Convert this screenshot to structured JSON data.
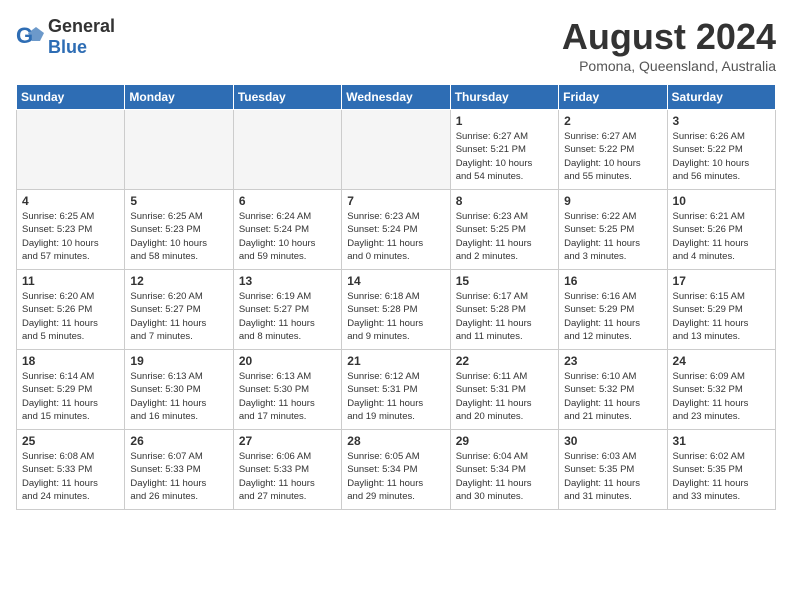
{
  "header": {
    "logo_general": "General",
    "logo_blue": "Blue",
    "month_title": "August 2024",
    "location": "Pomona, Queensland, Australia"
  },
  "weekdays": [
    "Sunday",
    "Monday",
    "Tuesday",
    "Wednesday",
    "Thursday",
    "Friday",
    "Saturday"
  ],
  "weeks": [
    [
      {
        "day": "",
        "info": ""
      },
      {
        "day": "",
        "info": ""
      },
      {
        "day": "",
        "info": ""
      },
      {
        "day": "",
        "info": ""
      },
      {
        "day": "1",
        "info": "Sunrise: 6:27 AM\nSunset: 5:21 PM\nDaylight: 10 hours\nand 54 minutes."
      },
      {
        "day": "2",
        "info": "Sunrise: 6:27 AM\nSunset: 5:22 PM\nDaylight: 10 hours\nand 55 minutes."
      },
      {
        "day": "3",
        "info": "Sunrise: 6:26 AM\nSunset: 5:22 PM\nDaylight: 10 hours\nand 56 minutes."
      }
    ],
    [
      {
        "day": "4",
        "info": "Sunrise: 6:25 AM\nSunset: 5:23 PM\nDaylight: 10 hours\nand 57 minutes."
      },
      {
        "day": "5",
        "info": "Sunrise: 6:25 AM\nSunset: 5:23 PM\nDaylight: 10 hours\nand 58 minutes."
      },
      {
        "day": "6",
        "info": "Sunrise: 6:24 AM\nSunset: 5:24 PM\nDaylight: 10 hours\nand 59 minutes."
      },
      {
        "day": "7",
        "info": "Sunrise: 6:23 AM\nSunset: 5:24 PM\nDaylight: 11 hours\nand 0 minutes."
      },
      {
        "day": "8",
        "info": "Sunrise: 6:23 AM\nSunset: 5:25 PM\nDaylight: 11 hours\nand 2 minutes."
      },
      {
        "day": "9",
        "info": "Sunrise: 6:22 AM\nSunset: 5:25 PM\nDaylight: 11 hours\nand 3 minutes."
      },
      {
        "day": "10",
        "info": "Sunrise: 6:21 AM\nSunset: 5:26 PM\nDaylight: 11 hours\nand 4 minutes."
      }
    ],
    [
      {
        "day": "11",
        "info": "Sunrise: 6:20 AM\nSunset: 5:26 PM\nDaylight: 11 hours\nand 5 minutes."
      },
      {
        "day": "12",
        "info": "Sunrise: 6:20 AM\nSunset: 5:27 PM\nDaylight: 11 hours\nand 7 minutes."
      },
      {
        "day": "13",
        "info": "Sunrise: 6:19 AM\nSunset: 5:27 PM\nDaylight: 11 hours\nand 8 minutes."
      },
      {
        "day": "14",
        "info": "Sunrise: 6:18 AM\nSunset: 5:28 PM\nDaylight: 11 hours\nand 9 minutes."
      },
      {
        "day": "15",
        "info": "Sunrise: 6:17 AM\nSunset: 5:28 PM\nDaylight: 11 hours\nand 11 minutes."
      },
      {
        "day": "16",
        "info": "Sunrise: 6:16 AM\nSunset: 5:29 PM\nDaylight: 11 hours\nand 12 minutes."
      },
      {
        "day": "17",
        "info": "Sunrise: 6:15 AM\nSunset: 5:29 PM\nDaylight: 11 hours\nand 13 minutes."
      }
    ],
    [
      {
        "day": "18",
        "info": "Sunrise: 6:14 AM\nSunset: 5:29 PM\nDaylight: 11 hours\nand 15 minutes."
      },
      {
        "day": "19",
        "info": "Sunrise: 6:13 AM\nSunset: 5:30 PM\nDaylight: 11 hours\nand 16 minutes."
      },
      {
        "day": "20",
        "info": "Sunrise: 6:13 AM\nSunset: 5:30 PM\nDaylight: 11 hours\nand 17 minutes."
      },
      {
        "day": "21",
        "info": "Sunrise: 6:12 AM\nSunset: 5:31 PM\nDaylight: 11 hours\nand 19 minutes."
      },
      {
        "day": "22",
        "info": "Sunrise: 6:11 AM\nSunset: 5:31 PM\nDaylight: 11 hours\nand 20 minutes."
      },
      {
        "day": "23",
        "info": "Sunrise: 6:10 AM\nSunset: 5:32 PM\nDaylight: 11 hours\nand 21 minutes."
      },
      {
        "day": "24",
        "info": "Sunrise: 6:09 AM\nSunset: 5:32 PM\nDaylight: 11 hours\nand 23 minutes."
      }
    ],
    [
      {
        "day": "25",
        "info": "Sunrise: 6:08 AM\nSunset: 5:33 PM\nDaylight: 11 hours\nand 24 minutes."
      },
      {
        "day": "26",
        "info": "Sunrise: 6:07 AM\nSunset: 5:33 PM\nDaylight: 11 hours\nand 26 minutes."
      },
      {
        "day": "27",
        "info": "Sunrise: 6:06 AM\nSunset: 5:33 PM\nDaylight: 11 hours\nand 27 minutes."
      },
      {
        "day": "28",
        "info": "Sunrise: 6:05 AM\nSunset: 5:34 PM\nDaylight: 11 hours\nand 29 minutes."
      },
      {
        "day": "29",
        "info": "Sunrise: 6:04 AM\nSunset: 5:34 PM\nDaylight: 11 hours\nand 30 minutes."
      },
      {
        "day": "30",
        "info": "Sunrise: 6:03 AM\nSunset: 5:35 PM\nDaylight: 11 hours\nand 31 minutes."
      },
      {
        "day": "31",
        "info": "Sunrise: 6:02 AM\nSunset: 5:35 PM\nDaylight: 11 hours\nand 33 minutes."
      }
    ]
  ]
}
